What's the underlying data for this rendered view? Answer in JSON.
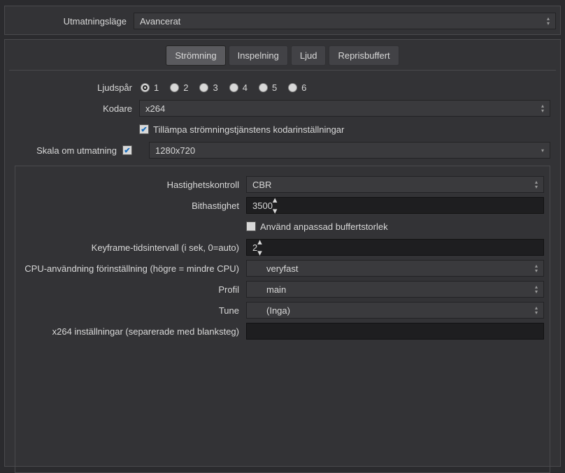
{
  "top": {
    "outputModeLabel": "Utmatningsläge",
    "outputModeValue": "Avancerat"
  },
  "tabs": {
    "streaming": "Strömning",
    "recording": "Inspelning",
    "audio": "Ljud",
    "replay": "Reprisbuffert"
  },
  "streaming": {
    "audioTrackLabel": "Ljudspår",
    "tracks": [
      "1",
      "2",
      "3",
      "4",
      "5",
      "6"
    ],
    "selectedTrack": 1,
    "encoderLabel": "Kodare",
    "encoderValue": "x264",
    "enforceServiceLabel": "Tillämpa strömningstjänstens kodarinställningar",
    "rescaleLabel": "Skala om utmatning",
    "rescaleValue": "1280x720"
  },
  "encoder": {
    "rateControlLabel": "Hastighetskontroll",
    "rateControlValue": "CBR",
    "bitrateLabel": "Bithastighet",
    "bitrateValue": "3500",
    "customBufferLabel": "Använd anpassad buffertstorlek",
    "keyframeLabel": "Keyframe-tidsintervall (i sek, 0=auto)",
    "keyframeValue": "2",
    "cpuPresetLabel": "CPU-användning förinställning (högre = mindre CPU)",
    "cpuPresetValue": "veryfast",
    "profileLabel": "Profil",
    "profileValue": "main",
    "tuneLabel": "Tune",
    "tuneValue": "(Inga)",
    "x264optsLabel": "x264 inställningar (separerade med blanksteg)",
    "x264optsValue": ""
  }
}
